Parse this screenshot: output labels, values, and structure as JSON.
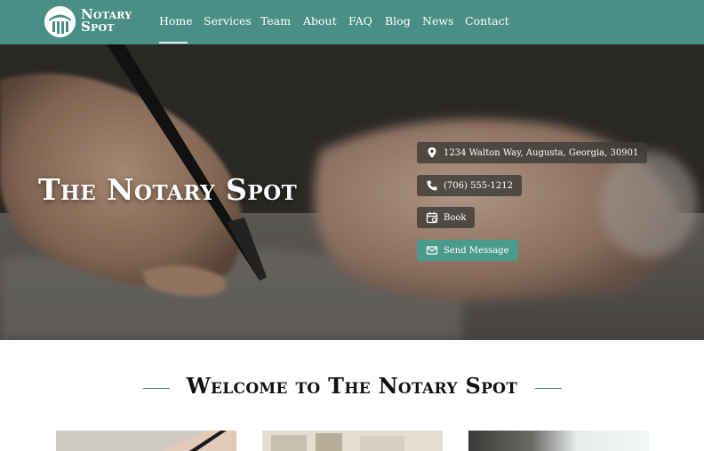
{
  "brand": {
    "line1": "Notary",
    "line2": "Spot"
  },
  "nav": {
    "items": [
      {
        "label": "Home",
        "active": true
      },
      {
        "label": "Services"
      },
      {
        "label": "Team"
      },
      {
        "label": "About"
      },
      {
        "label": "FAQ"
      },
      {
        "label": "Blog"
      },
      {
        "label": "News"
      },
      {
        "label": "Contact"
      }
    ]
  },
  "hero": {
    "title": "The Notary Spot",
    "address": "1234 Walton Way, Augusta, Georgia, 30901",
    "phone": "(706) 555-1212",
    "book_label": "Book",
    "message_label": "Send Message"
  },
  "welcome": {
    "title": "Welcome to The Notary Spot"
  },
  "colors": {
    "brand_teal": "#4a8f85",
    "accent_teal": "#4a9a8e",
    "chip_dark": "#3e3c38"
  },
  "icons": {
    "address": "map-pin-icon",
    "phone": "phone-icon",
    "book": "calendar-icon",
    "message": "envelope-icon"
  }
}
